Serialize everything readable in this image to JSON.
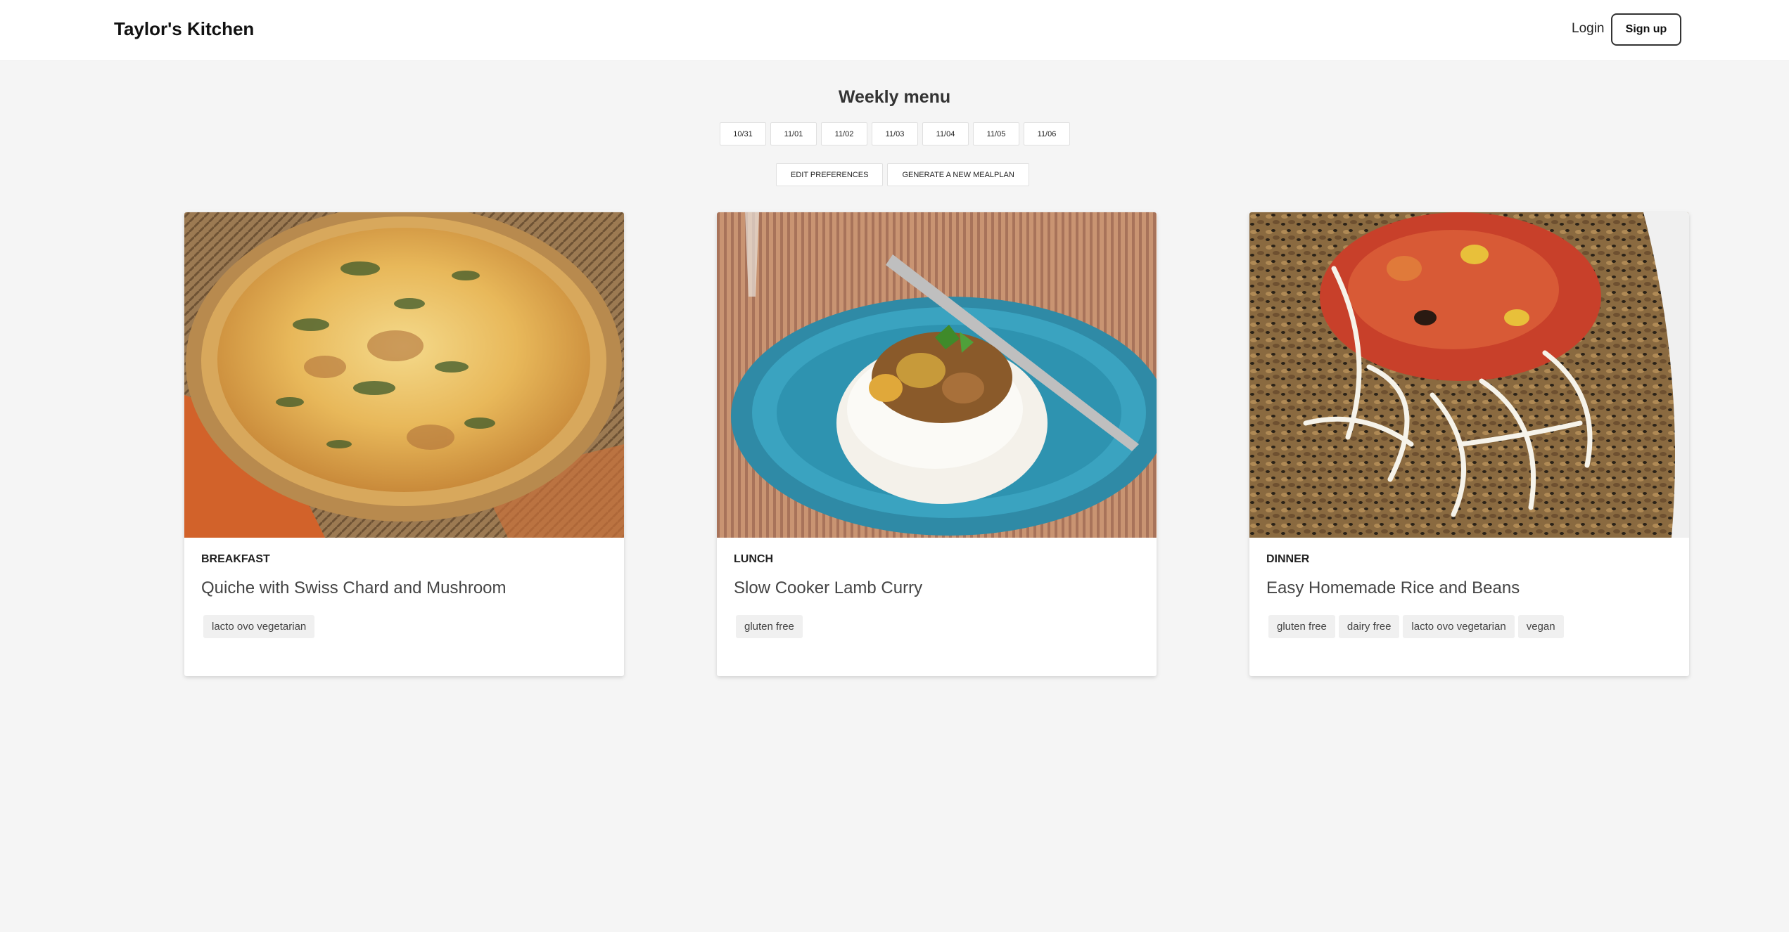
{
  "header": {
    "brand": "Taylor's Kitchen",
    "login_label": "Login",
    "signup_label": "Sign up"
  },
  "menu": {
    "title": "Weekly menu",
    "dates": [
      "10/31",
      "11/01",
      "11/02",
      "11/03",
      "11/04",
      "11/05",
      "11/06"
    ],
    "actions": [
      "EDIT PREFERENCES",
      "GENERATE A NEW MEALPLAN"
    ]
  },
  "cards": [
    {
      "meal_type": "BREAKFAST",
      "title": "Quiche with Swiss Chard and Mushroom",
      "tags": [
        "lacto ovo vegetarian"
      ]
    },
    {
      "meal_type": "LUNCH",
      "title": "Slow Cooker Lamb Curry",
      "tags": [
        "gluten free"
      ]
    },
    {
      "meal_type": "DINNER",
      "title": "Easy Homemade Rice and Beans",
      "tags": [
        "gluten free",
        "dairy free",
        "lacto ovo vegetarian",
        "vegan"
      ]
    }
  ],
  "colors": {
    "page_background": "#f5f5f5",
    "header_background": "#ffffff",
    "card_background": "#ffffff",
    "tag_background": "#f0f0f0"
  }
}
